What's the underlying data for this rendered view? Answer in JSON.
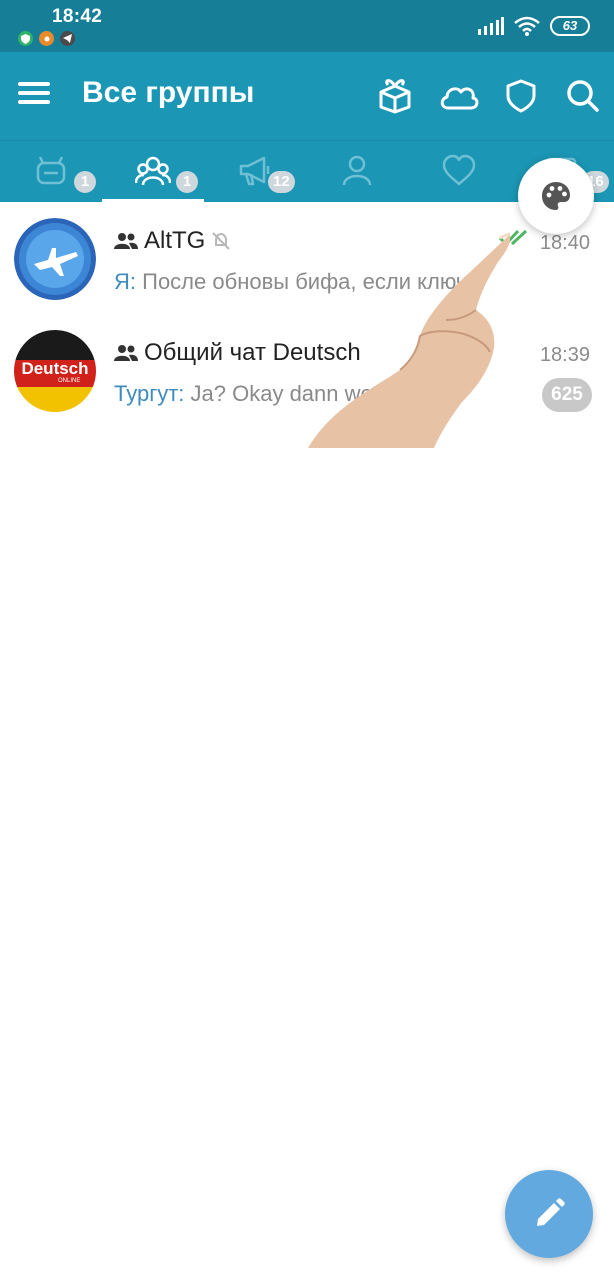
{
  "status_bar": {
    "time": "18:42",
    "battery": "63",
    "icons": [
      "shield-icon",
      "orange-app-icon",
      "telegram-icon",
      "signal-icon",
      "wifi-icon",
      "battery-icon"
    ]
  },
  "header": {
    "title": "Все группы",
    "icons": [
      "menu-icon",
      "gift-box-icon",
      "cloud-icon",
      "shield-icon",
      "search-icon"
    ]
  },
  "tabs": [
    {
      "icon": "bot-icon",
      "badge": "1"
    },
    {
      "icon": "groups-icon",
      "badge": "1",
      "active": true
    },
    {
      "icon": "megaphone-icon",
      "badge": "12"
    },
    {
      "icon": "user-icon",
      "badge": ""
    },
    {
      "icon": "heart-icon",
      "badge": ""
    },
    {
      "icon": "folder-icon",
      "badge": "16"
    }
  ],
  "chats": [
    {
      "name": "AltTG",
      "muted": true,
      "time": "18:40",
      "sender": "Я:",
      "message": "После обновы бифа, если ключ...",
      "read": true
    },
    {
      "name": "Общий чат Deutsch",
      "muted": false,
      "time": "18:39",
      "sender": "Тургут:",
      "message": "Ja? Okay dann werde...",
      "unread": "625",
      "avatar_text": "Deutsch",
      "avatar_subtext": "ONLINE"
    }
  ],
  "colors": {
    "status_bar": "#167f97",
    "header": "#1b96b4",
    "sender": "#3e8bbd",
    "fab": "#62a9df",
    "badge": "#cdd7dc"
  },
  "palette_button": {
    "icon": "palette-icon"
  },
  "fab": {
    "icon": "pencil-icon"
  }
}
